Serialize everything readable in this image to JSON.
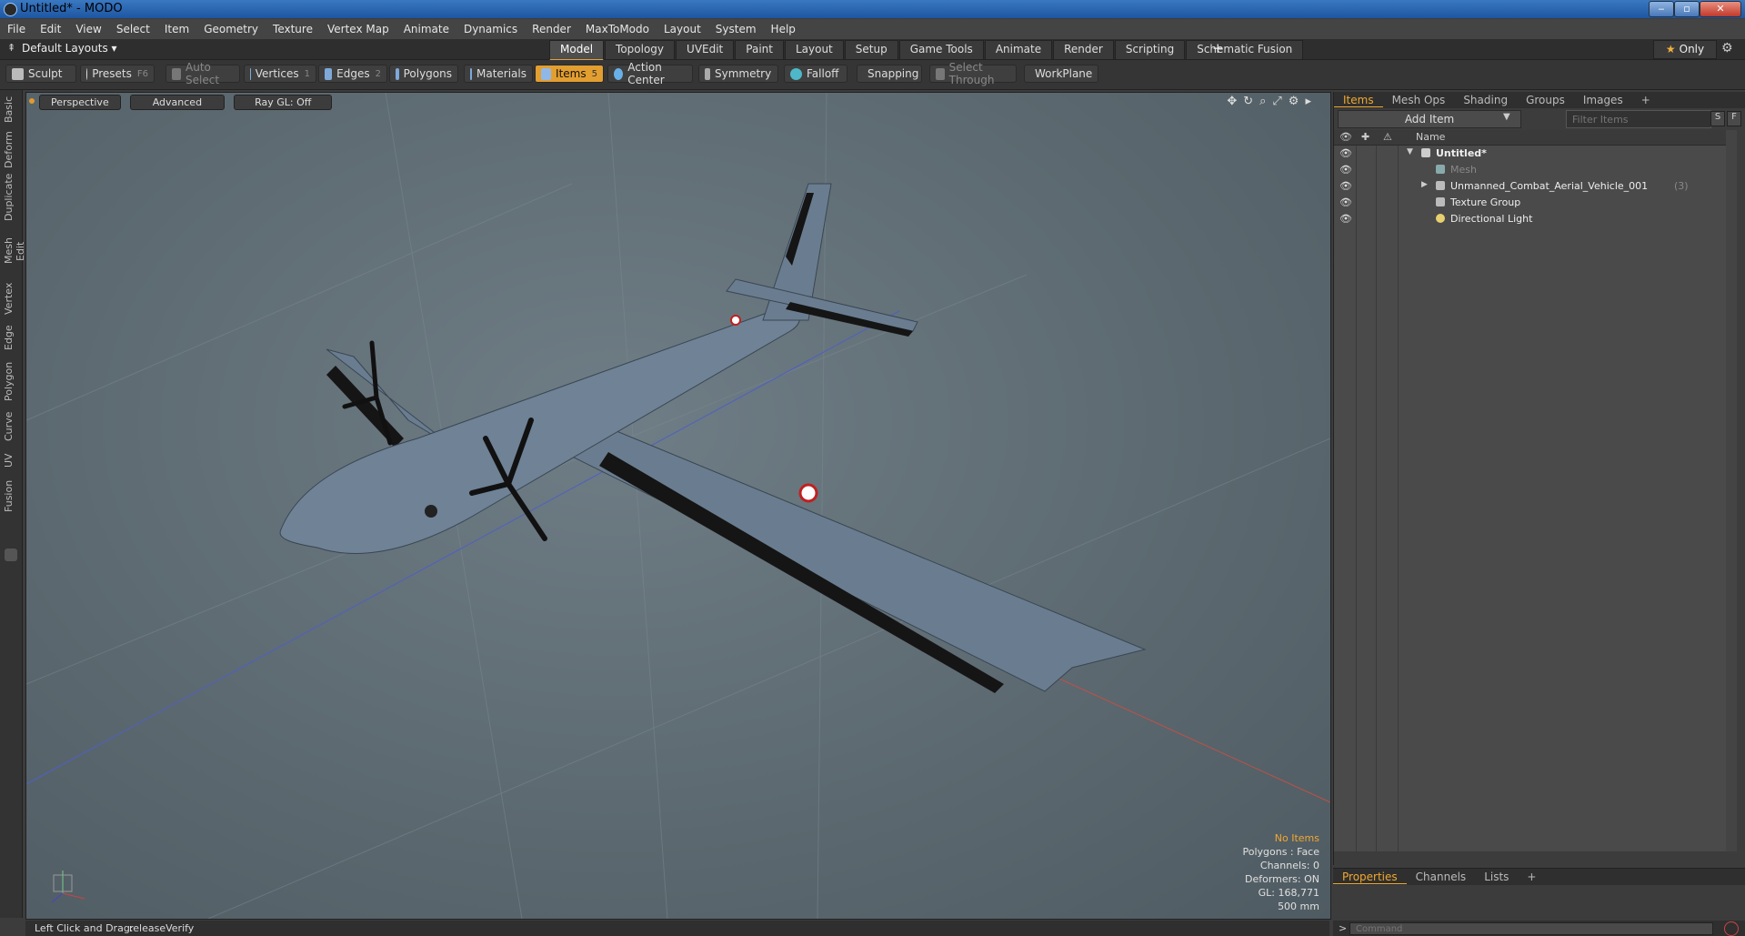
{
  "window": {
    "title": "Untitled* - MODO",
    "minimize": "‒",
    "maximize": "▫",
    "close": "✕"
  },
  "menu": [
    "File",
    "Edit",
    "View",
    "Select",
    "Item",
    "Geometry",
    "Texture",
    "Vertex Map",
    "Animate",
    "Dynamics",
    "Render",
    "MaxToModo",
    "Layout",
    "System",
    "Help"
  ],
  "layout": {
    "selector": "Default Layouts ▾",
    "tabs": [
      "Model",
      "Topology",
      "UVEdit",
      "Paint",
      "Layout",
      "Setup",
      "Game Tools",
      "Animate",
      "Render",
      "Scripting",
      "Schematic Fusion"
    ],
    "active_tab": "Model",
    "plus": "+",
    "only": "Only",
    "star": "★",
    "gear": "⚙"
  },
  "toolbar": {
    "sculpt": "Sculpt",
    "presets": "Presets",
    "presets_key": "F6",
    "auto_select": "Auto Select",
    "vertices": "Vertices",
    "vertices_key": "1",
    "edges": "Edges",
    "edges_key": "2",
    "polygons": "Polygons",
    "materials": "Materials",
    "items": "Items",
    "items_key": "5",
    "action_center": "Action Center",
    "symmetry": "Symmetry",
    "falloff": "Falloff",
    "snapping": "Snapping",
    "select_through": "Select Through",
    "workplane": "WorkPlane"
  },
  "left_tabs": [
    "Basic",
    "Deform",
    "Duplicate",
    "Mesh Edit",
    "Vertex",
    "Edge",
    "Polygon",
    "Curve",
    "UV",
    "Fusion"
  ],
  "viewport": {
    "perspective": "Perspective",
    "advanced": "Advanced",
    "raygl": "Ray GL: Off",
    "icons": "✥↻⌕⤢⚙▸",
    "stats": {
      "no_items": "No Items",
      "polygons": "Polygons : Face",
      "channels": "Channels: 0",
      "deformers": "Deformers: ON",
      "gl": "GL: 168,771",
      "scale": "500 mm"
    }
  },
  "items_panel": {
    "tabs": [
      "Items",
      "Mesh Ops",
      "Shading",
      "Groups",
      "Images",
      "+"
    ],
    "active_tab": "Items",
    "add_item": "Add Item",
    "filter_placeholder": "Filter Items",
    "s_btn": "S",
    "f_btn": "F",
    "col_name": "Name",
    "rows": [
      {
        "label": "Untitled*",
        "bold": true
      },
      {
        "label": "Mesh",
        "dim": true
      },
      {
        "label": "Unmanned_Combat_Aerial_Vehicle_001",
        "count": "(3)"
      },
      {
        "label": "Texture Group"
      },
      {
        "label": "Directional Light"
      }
    ]
  },
  "properties_panel": {
    "tabs": [
      "Properties",
      "Channels",
      "Lists",
      "+"
    ],
    "active_tab": "Properties"
  },
  "status": {
    "left": "Left Click and Drag:",
    "action": "releaseVerify"
  },
  "command": {
    "placeholder": "Command",
    "prompt": ">"
  },
  "colors": {
    "accent": "#e39e30",
    "viewport": "#5f6c73",
    "title": "#1e56a0"
  }
}
